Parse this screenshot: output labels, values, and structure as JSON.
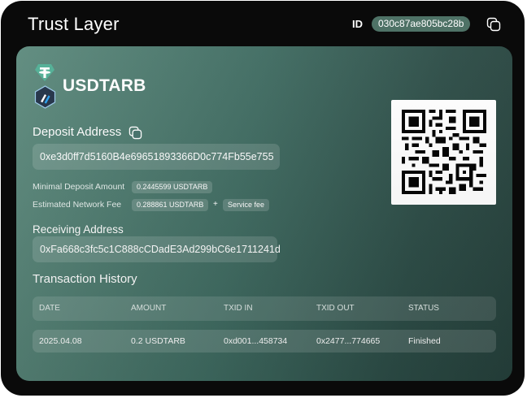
{
  "app": {
    "title": "Trust Layer",
    "id_label": "ID",
    "id_value": "030c87ae805bc28b"
  },
  "token": {
    "name": "USDTARB",
    "icons": [
      "tether-icon",
      "arbitrum-icon"
    ]
  },
  "deposit": {
    "label": "Deposit Address",
    "address": "0xe3d0ff7d5160B4e69651893366D0c774Fb55e755",
    "minimal_label": "Minimal Deposit Amount",
    "minimal_value": "0.2445599 USDTARB",
    "fee_label": "Estimated Network Fee",
    "fee_value": "0.288861 USDTARB",
    "fee_plus": "+",
    "service_fee": "Service fee"
  },
  "receiving": {
    "label": "Receiving Address",
    "address": "0xFa668c3fc5c1C888cCDadE3Ad299bC6e1711241d"
  },
  "history": {
    "title": "Transaction History",
    "columns": [
      "DATE",
      "AMOUNT",
      "TXID IN",
      "TXID OUT",
      "STATUS"
    ],
    "rows": [
      [
        "2025.04.08",
        "0.2 USDTARB",
        "0xd001...458734",
        "0x2477...774665",
        "Finished"
      ]
    ]
  },
  "colors": {
    "frame": "#0a0a0a",
    "card_start": "#5d8a7d",
    "card_end": "#25403b",
    "id_pill": "#4e7266",
    "tether_green": "#50af95",
    "arbitrum_blue": "#28a0f0",
    "arbitrum_navy": "#213147"
  }
}
